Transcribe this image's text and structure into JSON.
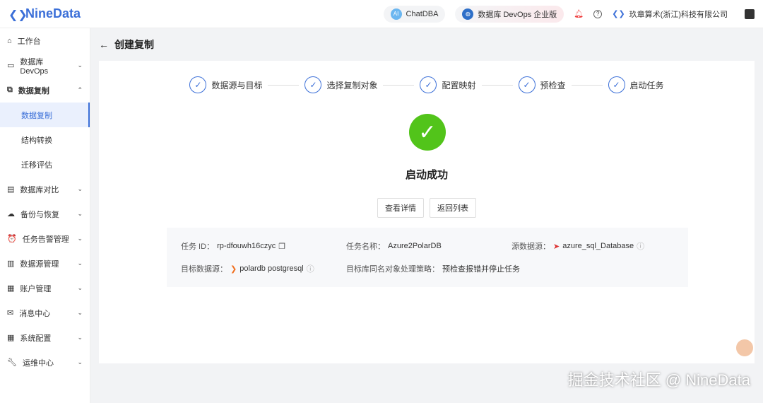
{
  "header": {
    "logo": "NineData",
    "chatdba": "ChatDBA",
    "edition": "数据库 DevOps 企业版",
    "org": "玖章算术(浙江)科技有限公司"
  },
  "sidebar": [
    {
      "label": "工作台",
      "icon": "home-icon"
    },
    {
      "label": "数据库 DevOps",
      "icon": "monitor-icon",
      "chev": "⌄"
    },
    {
      "label": "数据复制",
      "icon": "copy-icon",
      "chev": "⌃"
    },
    {
      "label": "数据复制",
      "sub": true,
      "active": true
    },
    {
      "label": "结构转换",
      "sub": true
    },
    {
      "label": "迁移评估",
      "sub": true
    },
    {
      "label": "数据库对比",
      "icon": "compare-icon",
      "chev": "⌄"
    },
    {
      "label": "备份与恢复",
      "icon": "cloud-icon",
      "chev": "⌄"
    },
    {
      "label": "任务告警管理",
      "icon": "alarm-icon",
      "chev": "⌄"
    },
    {
      "label": "数据源管理",
      "icon": "database-icon",
      "chev": "⌄"
    },
    {
      "label": "账户管理",
      "icon": "account-icon",
      "chev": "⌄"
    },
    {
      "label": "消息中心",
      "icon": "mail-icon",
      "chev": "⌄"
    },
    {
      "label": "系统配置",
      "icon": "grid-icon",
      "chev": "⌄"
    },
    {
      "label": "运维中心",
      "icon": "wrench-icon",
      "chev": "⌄"
    }
  ],
  "page": {
    "title": "创建复制",
    "steps": [
      "数据源与目标",
      "选择复制对象",
      "配置映射",
      "预检查",
      "启动任务"
    ],
    "result": "启动成功",
    "view_details": "查看详情",
    "back_list": "返回列表"
  },
  "info": {
    "task_id_label": "任务 ID：",
    "task_id": "rp-dfouwh16czyc",
    "task_name_label": "任务名称：",
    "task_name": "Azure2PolarDB",
    "source_label": "源数据源：",
    "source": "azure_sql_Database",
    "target_label": "目标数据源：",
    "target": "polardb postgresql",
    "policy_label": "目标库同名对象处理策略：",
    "policy": "预检查报错并停止任务"
  },
  "watermark": "掘金技术社区 @ NineData"
}
